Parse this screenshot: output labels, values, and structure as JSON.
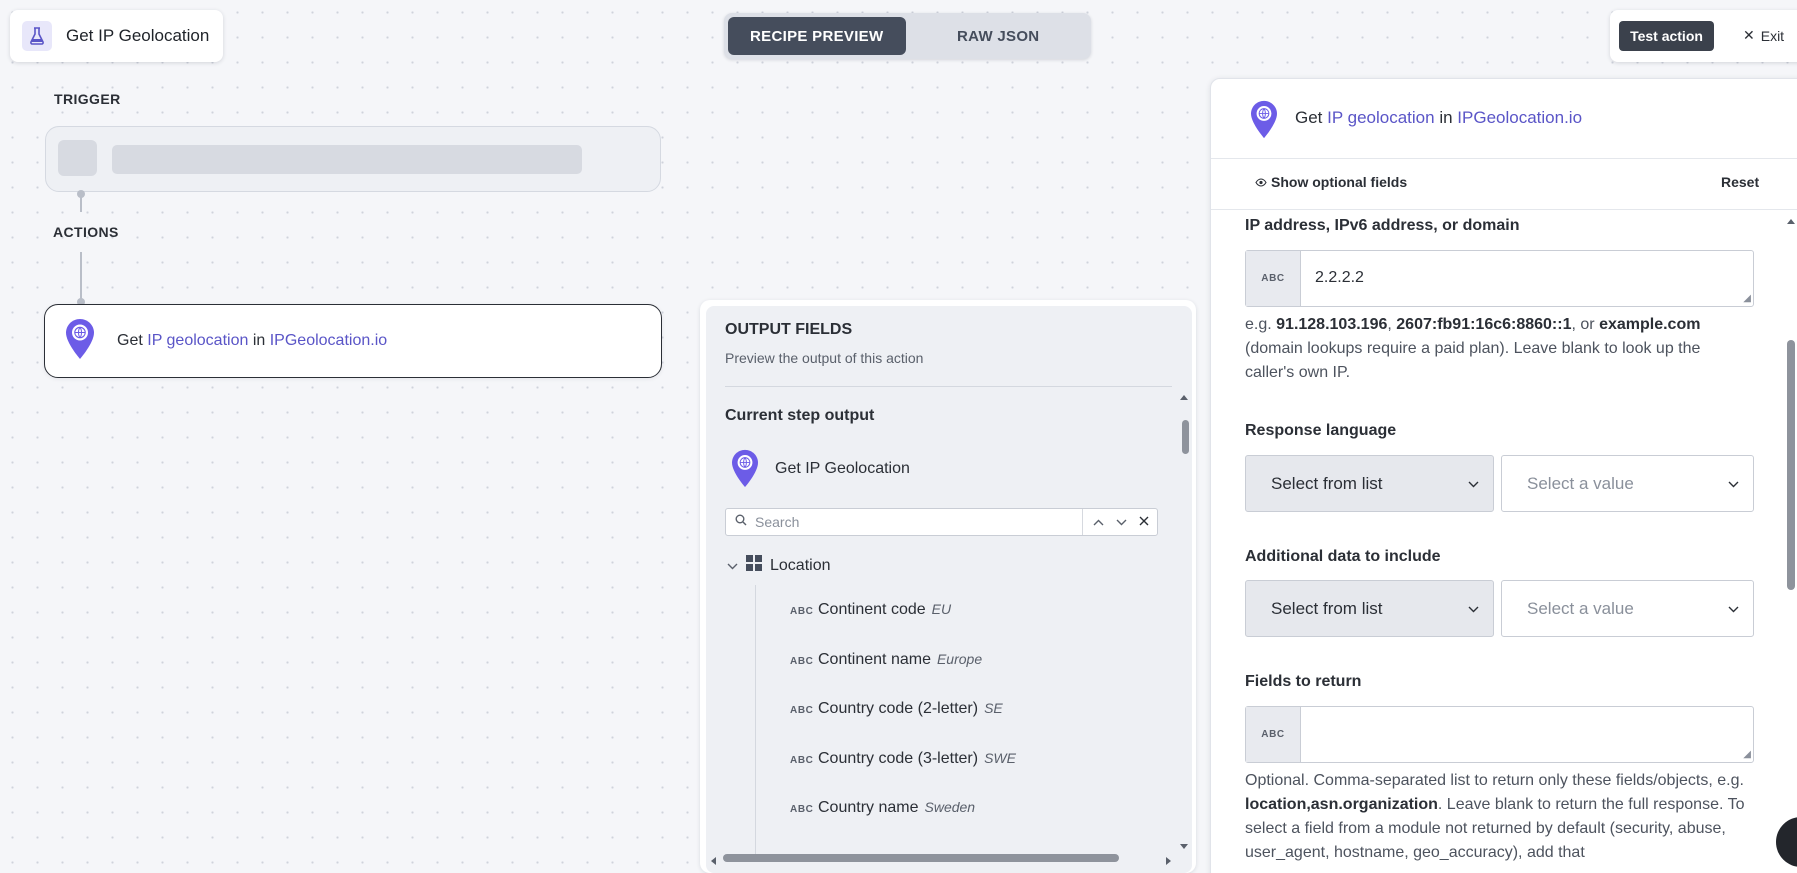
{
  "header": {
    "title": "Get IP Geolocation",
    "tabs": [
      {
        "label": "RECIPE PREVIEW",
        "active": true
      },
      {
        "label": "RAW JSON",
        "active": false
      }
    ],
    "test_action_label": "Test action",
    "exit_label": "Exit"
  },
  "canvas": {
    "trigger_label": "TRIGGER",
    "actions_label": "ACTIONS",
    "action": {
      "verb": "Get",
      "object": "IP geolocation",
      "connector_word": "in",
      "app": "IPGeolocation.io"
    }
  },
  "output_panel": {
    "title": "OUTPUT FIELDS",
    "subtitle": "Preview the output of this action",
    "current_step_label": "Current step output",
    "step_name": "Get IP Geolocation",
    "search_placeholder": "Search",
    "group_label": "Location",
    "type_tag": "ABC",
    "fields": [
      {
        "label": "Continent code",
        "value": "EU"
      },
      {
        "label": "Continent name",
        "value": "Europe"
      },
      {
        "label": "Country code (2-letter)",
        "value": "SE"
      },
      {
        "label": "Country code (3-letter)",
        "value": "SWE"
      },
      {
        "label": "Country name",
        "value": "Sweden"
      }
    ]
  },
  "config_panel": {
    "heading": {
      "verb": "Get",
      "object": "IP geolocation",
      "connector_word": "in",
      "app": "IPGeolocation.io"
    },
    "show_optional_label": "Show optional fields",
    "reset_label": "Reset",
    "type_tag": "ABC",
    "ip_field": {
      "label": "IP address, IPv6 address, or domain",
      "value": "2.2.2.2",
      "hint_prefix": "e.g.",
      "hint_ex1": "91.128.103.196",
      "hint_sep1": ",",
      "hint_ex2": "2607:fb91:16c6:8860::1",
      "hint_sep2": ", or",
      "hint_ex3": "example.com",
      "hint_suffix": "(domain lookups require a paid plan). Leave blank to look up the caller's own IP."
    },
    "response_language": {
      "label": "Response language",
      "mode": "Select from list",
      "placeholder": "Select a value"
    },
    "additional_data": {
      "label": "Additional data to include",
      "mode": "Select from list",
      "placeholder": "Select a value"
    },
    "fields_to_return": {
      "label": "Fields to return",
      "value": "",
      "hint_prefix": "Optional. Comma-separated list to return only these fields/objects, e.g.",
      "hint_example": "location,asn.organization",
      "hint_suffix": ". Leave blank to return the full response. To select a field from a module not returned by default (security, abuse, user_agent, hostname, geo_accuracy), add that"
    }
  },
  "colors": {
    "accent": "#5a55c7",
    "pin": "#6c5ce7",
    "dark_button": "#3b414c"
  }
}
